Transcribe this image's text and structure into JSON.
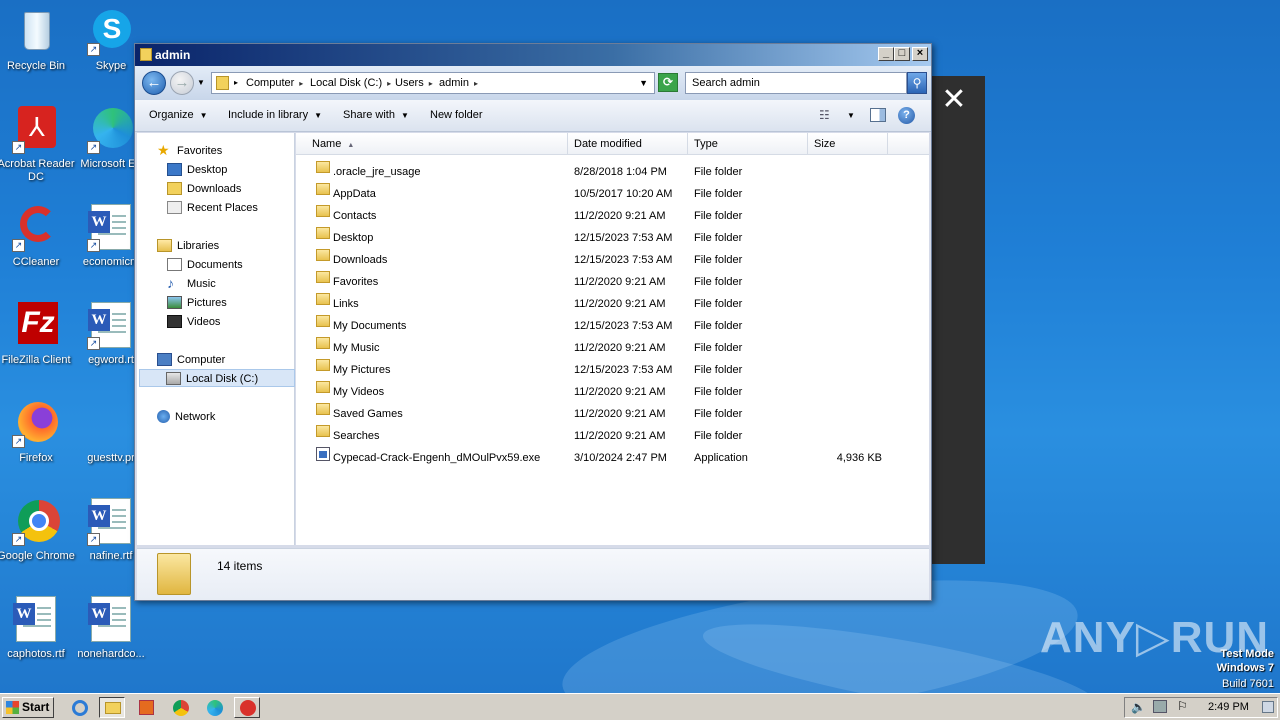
{
  "desktop": {
    "icons": [
      {
        "label": "Recycle Bin"
      },
      {
        "label": "Skype"
      },
      {
        "label": "Acrobat Reader DC"
      },
      {
        "label": "Microsoft Ed"
      },
      {
        "label": "CCleaner"
      },
      {
        "label": "economicm"
      },
      {
        "label": "FileZilla Client"
      },
      {
        "label": "egword.rt"
      },
      {
        "label": "Firefox"
      },
      {
        "label": "guesttv.pr"
      },
      {
        "label": "Google Chrome"
      },
      {
        "label": "nafine.rtf"
      },
      {
        "label": "caphotos.rtf"
      },
      {
        "label": "nonehardco..."
      }
    ]
  },
  "window": {
    "title": "admin",
    "min_label": "_",
    "max_label": "□",
    "close_label": "×",
    "breadcrumb": [
      "Computer",
      "Local Disk (C:)",
      "Users",
      "admin"
    ],
    "search_placeholder": "Search admin",
    "toolbar": {
      "organize": "Organize",
      "include_in_library": "Include in library",
      "share_with": "Share with",
      "new_folder": "New folder"
    },
    "nav": {
      "favorites": "Favorites",
      "desktop": "Desktop",
      "downloads": "Downloads",
      "recent_places": "Recent Places",
      "libraries": "Libraries",
      "documents": "Documents",
      "music": "Music",
      "pictures": "Pictures",
      "videos": "Videos",
      "computer": "Computer",
      "local_disk": "Local Disk (C:)",
      "network": "Network"
    },
    "columns": {
      "name": "Name",
      "date": "Date modified",
      "type": "Type",
      "size": "Size"
    },
    "files": [
      {
        "name": ".oracle_jre_usage",
        "date": "8/28/2018 1:04 PM",
        "type": "File folder",
        "size": ""
      },
      {
        "name": "AppData",
        "date": "10/5/2017 10:20 AM",
        "type": "File folder",
        "size": ""
      },
      {
        "name": "Contacts",
        "date": "11/2/2020 9:21 AM",
        "type": "File folder",
        "size": ""
      },
      {
        "name": "Desktop",
        "date": "12/15/2023 7:53 AM",
        "type": "File folder",
        "size": ""
      },
      {
        "name": "Downloads",
        "date": "12/15/2023 7:53 AM",
        "type": "File folder",
        "size": ""
      },
      {
        "name": "Favorites",
        "date": "11/2/2020 9:21 AM",
        "type": "File folder",
        "size": ""
      },
      {
        "name": "Links",
        "date": "11/2/2020 9:21 AM",
        "type": "File folder",
        "size": ""
      },
      {
        "name": "My Documents",
        "date": "12/15/2023 7:53 AM",
        "type": "File folder",
        "size": ""
      },
      {
        "name": "My Music",
        "date": "11/2/2020 9:21 AM",
        "type": "File folder",
        "size": ""
      },
      {
        "name": "My Pictures",
        "date": "12/15/2023 7:53 AM",
        "type": "File folder",
        "size": ""
      },
      {
        "name": "My Videos",
        "date": "11/2/2020 9:21 AM",
        "type": "File folder",
        "size": ""
      },
      {
        "name": "Saved Games",
        "date": "11/2/2020 9:21 AM",
        "type": "File folder",
        "size": ""
      },
      {
        "name": "Searches",
        "date": "11/2/2020 9:21 AM",
        "type": "File folder",
        "size": ""
      },
      {
        "name": "Cypecad-Crack-Engenh_dMOulPvx59.exe",
        "date": "3/10/2024 2:47 PM",
        "type": "Application",
        "size": "4,936 KB"
      }
    ],
    "status": "14 items"
  },
  "overlay": {
    "close_label": "✕"
  },
  "watermark": {
    "text": "ANY▷RUN"
  },
  "testmode": {
    "line1": "Test Mode",
    "line2": "Windows 7",
    "line3": "Build 7601"
  },
  "taskbar": {
    "start": "Start",
    "clock": "2:49 PM"
  },
  "colors": {
    "accent": "#0a246a",
    "desktop": "#1f7fd6"
  }
}
